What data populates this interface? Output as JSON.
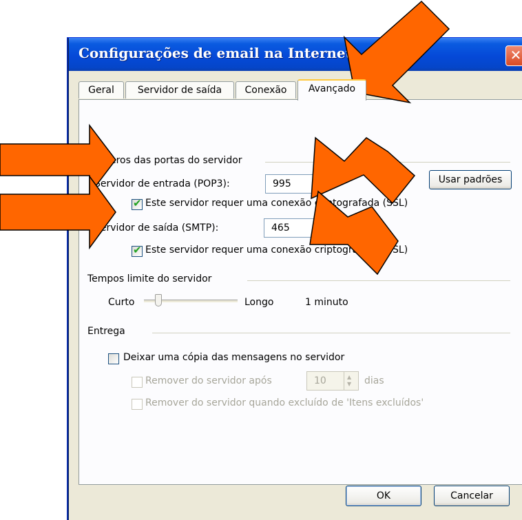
{
  "window": {
    "title": "Configurações de email na Internet",
    "close_glyph": "✕"
  },
  "tabs": [
    {
      "label": "Geral",
      "active": false
    },
    {
      "label": "Servidor de saída",
      "active": false
    },
    {
      "label": "Conexão",
      "active": false
    },
    {
      "label": "Avançado",
      "active": true
    }
  ],
  "ports_group": {
    "title": "Números das portas do servidor",
    "incoming_label": "Servidor de entrada (POP3):",
    "incoming_value": "995",
    "incoming_ssl_label": "Este servidor requer uma conexão criptografada (SSL)",
    "incoming_ssl_checked": true,
    "outgoing_label": "Servidor de saída (SMTP):",
    "outgoing_value": "465",
    "outgoing_ssl_label": "Este servidor requer uma conexão criptografada (SSL)",
    "outgoing_ssl_checked": true,
    "defaults_button": "Usar padrões"
  },
  "timeout_group": {
    "title": "Tempos limite do servidor",
    "short_label": "Curto",
    "long_label": "Longo",
    "value_label": "1 minuto"
  },
  "delivery_group": {
    "title": "Entrega",
    "leave_copy_label": "Deixar uma cópia das mensagens no servidor",
    "leave_copy_checked": false,
    "remove_after_label": "Remover do servidor após",
    "remove_after_days": "10",
    "days_label": "dias",
    "remove_deleted_label": "Remover do servidor quando excluído de 'Itens excluídos'"
  },
  "buttons": {
    "ok": "OK",
    "cancel": "Cancelar"
  },
  "colors": {
    "arrow_fill": "#ff6600",
    "arrow_stroke": "#000000",
    "title_bar": "#0549d8",
    "check": "#21a121"
  }
}
